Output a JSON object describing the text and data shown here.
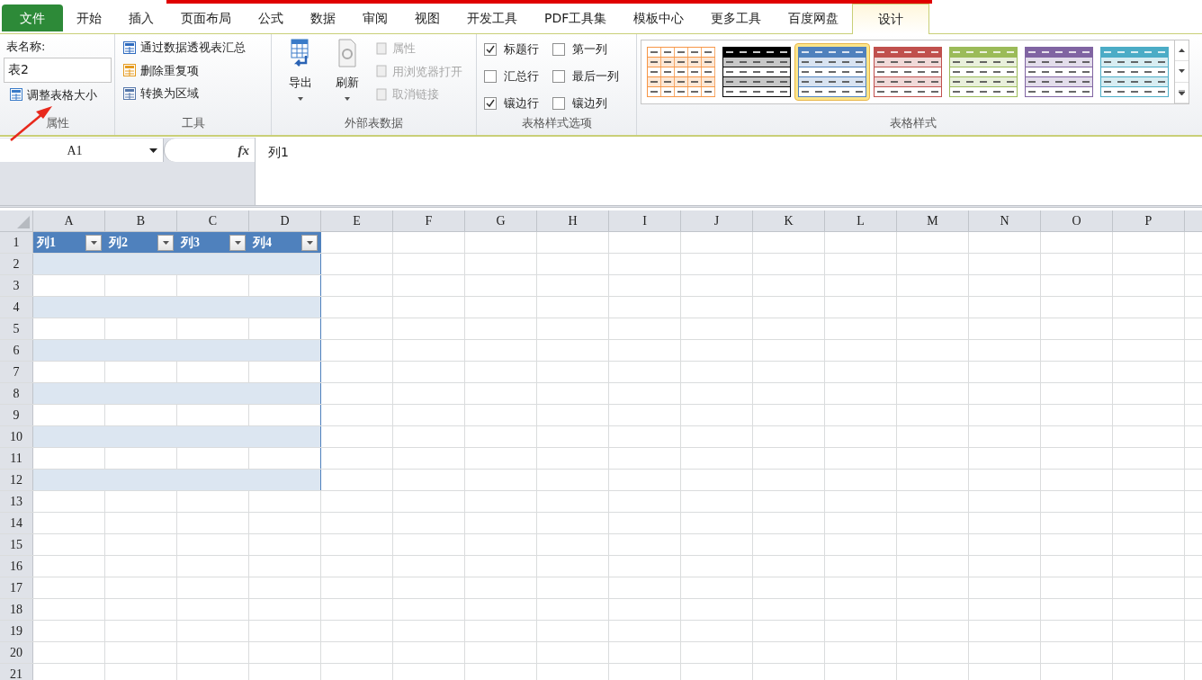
{
  "tabs": [
    {
      "label": "文件",
      "kind": "file",
      "selected": false
    },
    {
      "label": "开始",
      "kind": "tab",
      "selected": false
    },
    {
      "label": "插入",
      "kind": "tab",
      "selected": false
    },
    {
      "label": "页面布局",
      "kind": "tab",
      "selected": false
    },
    {
      "label": "公式",
      "kind": "tab",
      "selected": false
    },
    {
      "label": "数据",
      "kind": "tab",
      "selected": false
    },
    {
      "label": "审阅",
      "kind": "tab",
      "selected": false
    },
    {
      "label": "视图",
      "kind": "tab",
      "selected": false
    },
    {
      "label": "开发工具",
      "kind": "tab",
      "selected": false
    },
    {
      "label": "PDF工具集",
      "kind": "tab",
      "selected": false
    },
    {
      "label": "模板中心",
      "kind": "tab",
      "selected": false
    },
    {
      "label": "更多工具",
      "kind": "tab",
      "selected": false
    },
    {
      "label": "百度网盘",
      "kind": "tab",
      "selected": false
    },
    {
      "label": "设计",
      "kind": "tab",
      "selected": true
    }
  ],
  "ribbon": {
    "properties": {
      "name_label": "表名称:",
      "name_value": "表2",
      "resize": "调整表格大小",
      "label": "属性"
    },
    "tools": {
      "items": [
        "通过数据透视表汇总",
        "删除重复项",
        "转换为区域"
      ],
      "label": "工具"
    },
    "external": {
      "big": [
        {
          "label": "导出",
          "kind": "export"
        },
        {
          "label": "刷新",
          "kind": "refresh"
        }
      ],
      "small": [
        {
          "label": "属性",
          "disabled": true
        },
        {
          "label": "用浏览器打开",
          "disabled": true
        },
        {
          "label": "取消链接",
          "disabled": true
        }
      ],
      "label": "外部表数据"
    },
    "options": {
      "checkboxes": [
        {
          "label": "标题行",
          "checked": true
        },
        {
          "label": "第一列",
          "checked": false
        },
        {
          "label": "汇总行",
          "checked": false
        },
        {
          "label": "最后一列",
          "checked": false
        },
        {
          "label": "镶边行",
          "checked": true
        },
        {
          "label": "镶边列",
          "checked": false
        }
      ],
      "label": "表格样式选项"
    },
    "styles": {
      "swatches": [
        {
          "kind": "grid",
          "color": "#f79646",
          "selected": false
        },
        {
          "kind": "header",
          "color": "#000000",
          "selected": false
        },
        {
          "kind": "header",
          "color": "#4f81bd",
          "selected": true
        },
        {
          "kind": "header",
          "color": "#c0504d",
          "selected": false
        },
        {
          "kind": "header",
          "color": "#9bbb59",
          "selected": false
        },
        {
          "kind": "header",
          "color": "#8064a2",
          "selected": false
        },
        {
          "kind": "header",
          "color": "#4bacc6",
          "selected": false
        }
      ],
      "label": "表格样式"
    }
  },
  "formula_bar": {
    "name_box": "A1",
    "fx_label": "fx",
    "formula": "列1"
  },
  "sheet": {
    "columns": [
      "A",
      "B",
      "C",
      "D",
      "E",
      "F",
      "G",
      "H",
      "I",
      "J",
      "K",
      "L",
      "M",
      "N",
      "O",
      "P"
    ],
    "table": {
      "headers": [
        "列1",
        "列2",
        "列3",
        "列4"
      ],
      "rows": [
        {
          "band": true
        },
        {
          "band": false
        },
        {
          "band": true
        },
        {
          "band": false
        },
        {
          "band": true
        },
        {
          "band": false
        },
        {
          "band": true
        },
        {
          "band": false
        },
        {
          "band": true
        },
        {
          "band": false
        },
        {
          "band": true
        }
      ]
    },
    "rows": [
      "1",
      "2",
      "3",
      "4",
      "5",
      "6",
      "7",
      "8",
      "9",
      "10",
      "11",
      "12",
      "13",
      "14",
      "15",
      "16",
      "17",
      "18",
      "19",
      "20",
      "21"
    ]
  }
}
